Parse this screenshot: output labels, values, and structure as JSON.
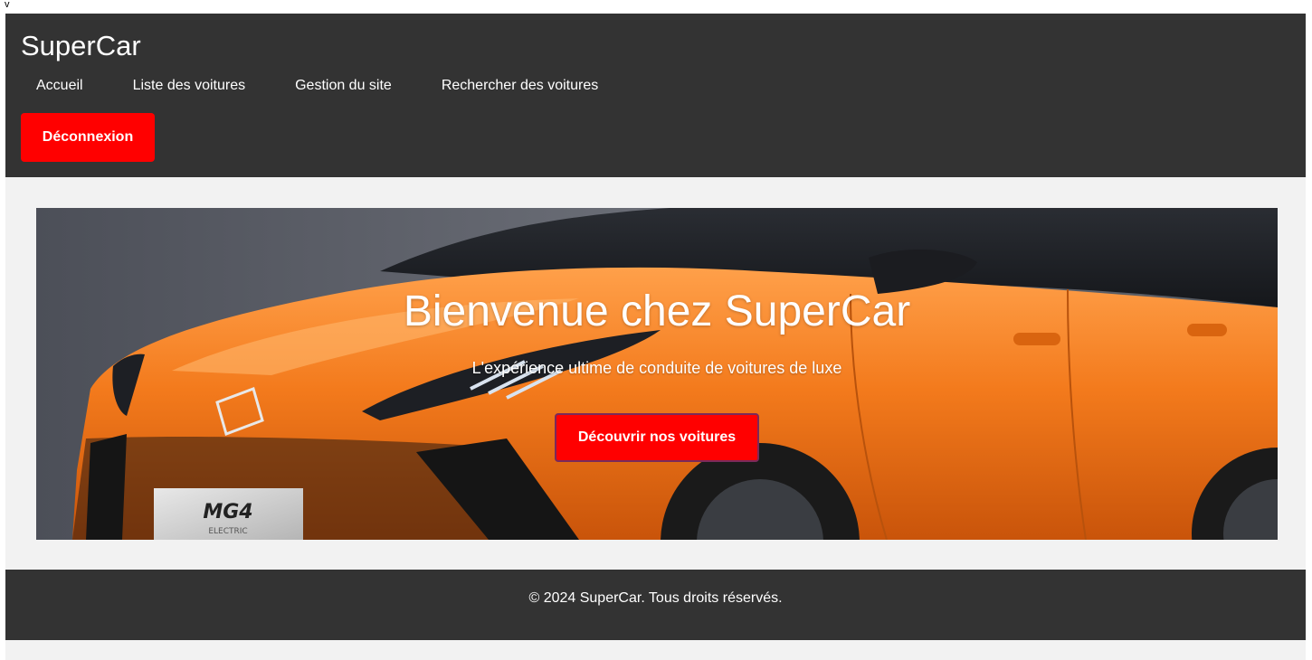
{
  "stray_text": "v",
  "header": {
    "logo": "SuperCar",
    "nav": [
      {
        "label": "Accueil"
      },
      {
        "label": "Liste des voitures"
      },
      {
        "label": "Gestion du site"
      },
      {
        "label": "Rechercher des voitures"
      }
    ],
    "logout_label": "Déconnexion"
  },
  "hero": {
    "title": "Bienvenue chez SuperCar",
    "subtitle": "L'expérience ultime de conduite de voitures de luxe",
    "cta_label": "Découvrir nos voitures",
    "plate_brand": "MG4",
    "plate_sub": "ELECTRIC"
  },
  "footer": {
    "copyright": "© 2024 SuperCar. Tous droits réservés."
  },
  "colors": {
    "header_bg": "#333333",
    "page_bg": "#f2f2f2",
    "accent_red": "#ff0000",
    "car_orange": "#f07a1a"
  }
}
